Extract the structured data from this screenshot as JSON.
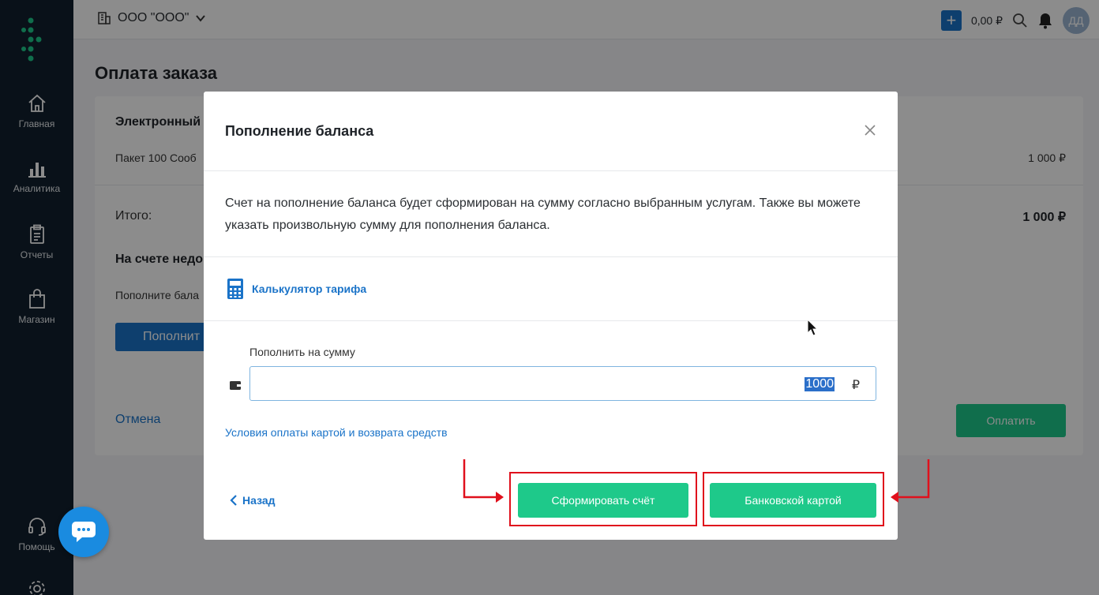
{
  "header": {
    "org_name": "ООО \"ООО\"",
    "balance": "0,00 ₽",
    "avatar_initials": "ДД"
  },
  "sidebar": {
    "items": [
      {
        "label": "Главная",
        "icon": "home-icon"
      },
      {
        "label": "Аналитика",
        "icon": "analytics-icon"
      },
      {
        "label": "Отчеты",
        "icon": "reports-icon"
      },
      {
        "label": "Магазин",
        "icon": "shop-icon"
      },
      {
        "label": "Помощь",
        "icon": "help-icon"
      }
    ]
  },
  "page": {
    "title": "Оплата заказа",
    "section_title": "Электронный",
    "item_name": "Пакет 100 Сооб",
    "item_price": "1 000 ₽",
    "total_label": "Итого:",
    "total_value": "1 000 ₽",
    "insufficient": "На счете недо",
    "topup_hint": "Пополните бала",
    "topup_button": "Пополнит",
    "cancel": "Отмена",
    "pay_button": "Оплатить"
  },
  "modal": {
    "title": "Пополнение баланса",
    "description": "Счет на пополнение баланса будет сформирован на сумму согласно выбранным услугам. Также вы можете указать произвольную сумму для пополнения баланса.",
    "calculator_link": "Калькулятор тарифа",
    "amount_label": "Пополнить на сумму",
    "amount_value": "1000",
    "currency": "₽",
    "terms_link": "Условия оплаты картой и возврата средств",
    "back": "Назад",
    "invoice_button": "Сформировать счёт",
    "card_button": "Банковской картой"
  },
  "colors": {
    "accent": "#1a73c8",
    "green": "#1ec98a",
    "sidebar": "#12202e",
    "highlight_red": "#e0101c"
  }
}
